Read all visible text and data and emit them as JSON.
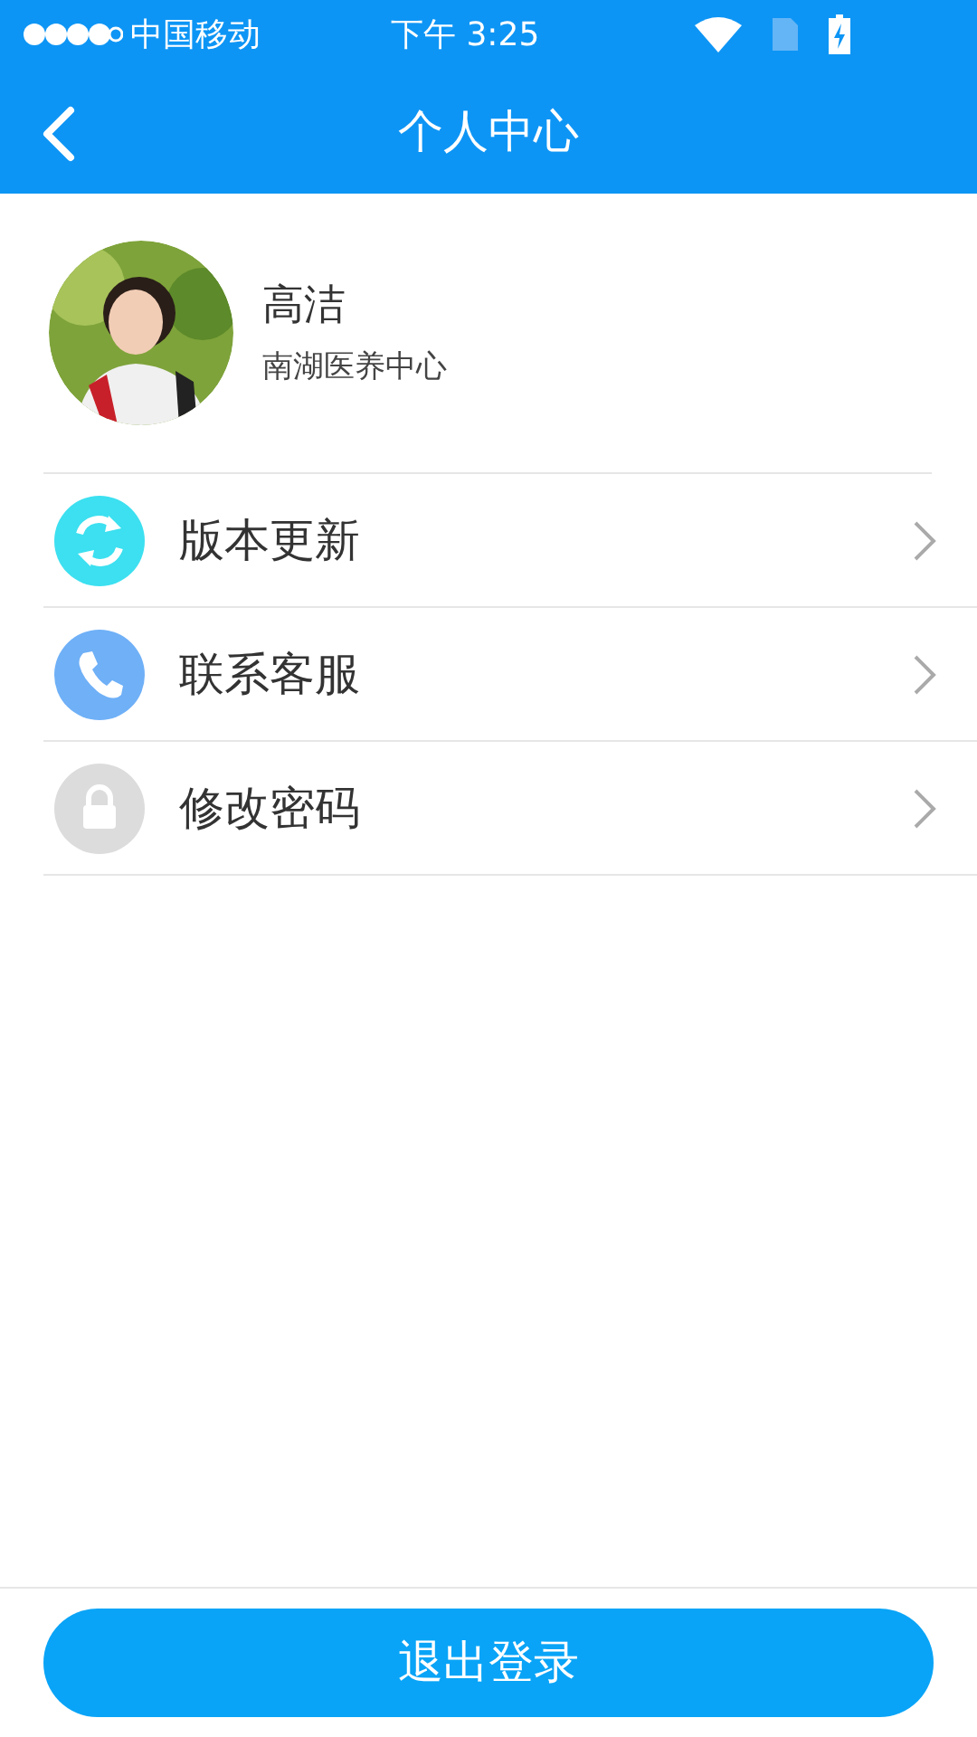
{
  "status_bar": {
    "carrier": "中国移动",
    "time": "下午 3:25"
  },
  "nav": {
    "title": "个人中心"
  },
  "profile": {
    "name": "高洁",
    "organization": "南湖医养中心"
  },
  "menu": [
    {
      "label": "版本更新",
      "kind": "update",
      "color": "#3ce0f0"
    },
    {
      "label": "联系客服",
      "kind": "phone",
      "color": "#6fb0f7"
    },
    {
      "label": "修改密码",
      "kind": "lock",
      "color": "#dcdcdc"
    }
  ],
  "logout_button": "退出登录"
}
